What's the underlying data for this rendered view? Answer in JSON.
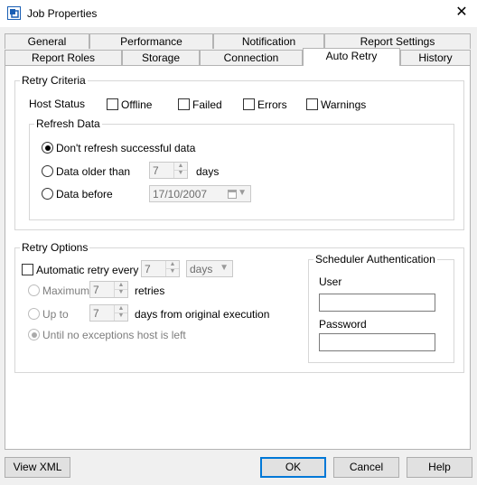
{
  "window": {
    "title": "Job Properties",
    "close_glyph": "✕"
  },
  "tabs": {
    "row1": [
      "General",
      "Performance",
      "Notification",
      "Report Settings"
    ],
    "row2": [
      "Report Roles",
      "Storage",
      "Connection",
      "Auto Retry",
      "History"
    ],
    "active": "Auto Retry"
  },
  "retry_criteria": {
    "legend": "Retry Criteria",
    "host_status_label": "Host Status",
    "host_status": [
      {
        "label": "Offline",
        "checked": false
      },
      {
        "label": "Failed",
        "checked": false
      },
      {
        "label": "Errors",
        "checked": false
      },
      {
        "label": "Warnings",
        "checked": false
      }
    ],
    "refresh": {
      "legend": "Refresh Data",
      "options": [
        {
          "label": "Don't refresh successful data",
          "checked": true
        },
        {
          "label": "Data older than",
          "checked": false
        },
        {
          "label": "Data before",
          "checked": false
        }
      ],
      "older_value": "7",
      "older_unit": "days",
      "before_date": "17/10/2007"
    }
  },
  "retry_options": {
    "legend": "Retry Options",
    "auto_retry_label": "Automatic retry every",
    "auto_retry_checked": false,
    "auto_retry_value": "7",
    "auto_retry_unit": "days",
    "maximum_label": "Maximum",
    "maximum_value": "7",
    "maximum_suffix": "retries",
    "upto_label": "Up to",
    "upto_value": "7",
    "upto_suffix": "days from original execution",
    "until_label": "Until no exceptions host is left",
    "until_checked": true
  },
  "scheduler_auth": {
    "legend": "Scheduler Authentication",
    "user_label": "User",
    "user_value": "",
    "password_label": "Password",
    "password_value": ""
  },
  "buttons": {
    "view_xml": "View XML",
    "ok": "OK",
    "cancel": "Cancel",
    "help": "Help"
  },
  "colors": {
    "accent": "#0078d7",
    "disabled_field": "#f3f3f3"
  }
}
